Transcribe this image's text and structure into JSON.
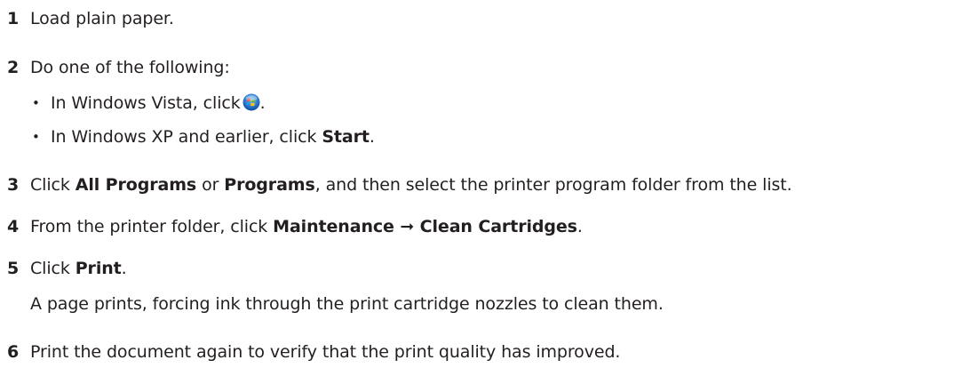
{
  "steps": [
    {
      "number": "1",
      "text": "Load plain paper."
    },
    {
      "number": "2",
      "text": "Do one of the following:",
      "options": [
        {
          "bullet": "•",
          "prefix": "In Windows Vista, click",
          "icon": "windows-start-orb-icon",
          "suffix": "."
        },
        {
          "bullet": "•",
          "prefix": "In Windows XP and earlier, click ",
          "bold": "Start",
          "suffix": "."
        }
      ]
    },
    {
      "number": "3",
      "prefix": "Click ",
      "bold1": "All Programs",
      "middle": " or ",
      "bold2": "Programs",
      "suffix": ", and then select the printer program folder from the list."
    },
    {
      "number": "4",
      "prefix": "From the printer folder, click ",
      "bold": "Maintenance ➞ Clean Cartridges",
      "suffix": "."
    },
    {
      "number": "5",
      "prefix": "Click ",
      "bold": "Print",
      "suffix": ".",
      "note": "A page prints, forcing ink through the print cartridge nozzles to clean them."
    },
    {
      "number": "6",
      "text": "Print the document again to verify that the print quality has improved."
    }
  ],
  "colors": {
    "text": "#231f20",
    "orb_blue": "#1f6fc9",
    "orb_red": "#e8412c",
    "orb_green": "#6ab42d",
    "orb_yellow": "#f7c21b"
  }
}
